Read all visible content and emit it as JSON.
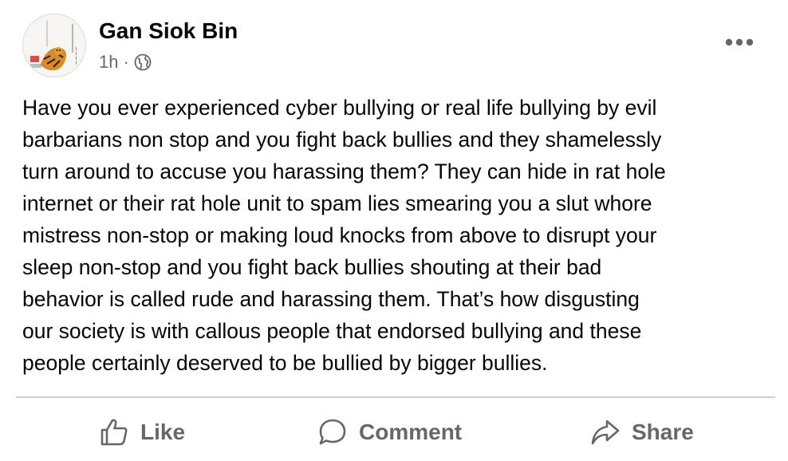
{
  "post": {
    "author": "Gan Siok Bin",
    "time": "1h",
    "separator": "·",
    "privacy_icon": "globe-icon",
    "more_icon": "more-horizontal-icon",
    "text": "Have you ever experienced cyber bullying or real life bullying by evil\nbarbarians non stop and you fight back bullies and they shamelessly\nturn around to accuse you harassing them? They can hide in rat hole\ninternet or their rat hole unit to spam lies smearing you a slut whore\nmistress non-stop or making loud knocks from above to disrupt your\nsleep non-stop and you fight back bullies shouting at their bad\nbehavior is called rude and harassing them. That’s how disgusting\nour society is with callous people that endorsed bullying and these\npeople certainly deserved to be bullied by bigger bullies."
  },
  "actions": {
    "like_label": "Like",
    "comment_label": "Comment",
    "share_label": "Share"
  },
  "colors": {
    "text": "#050505",
    "secondary": "#65676b",
    "divider": "#ced0d4"
  }
}
